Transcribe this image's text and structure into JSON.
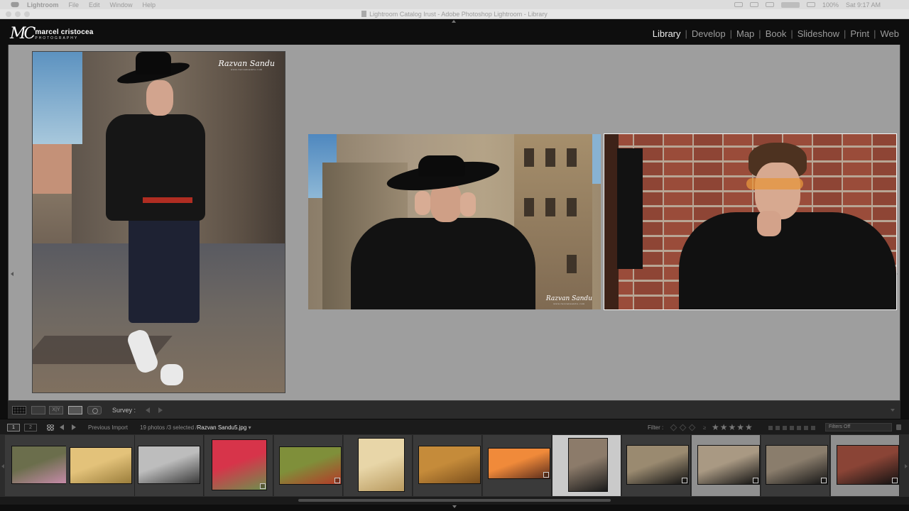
{
  "menubar": {
    "app_name": "Lightroom",
    "items": [
      "File",
      "Edit",
      "Window",
      "Help"
    ],
    "battery": "100%",
    "clock": "Sat 9:17 AM"
  },
  "window": {
    "title": "Lightroom Catalog Irust - Adobe Photoshop Lightroom - Library"
  },
  "identity": {
    "logo_mark": "MC",
    "logo_name": "marcel cristocea",
    "logo_sub": "PHOTOGRAPHY"
  },
  "modules": {
    "active": "Library",
    "items": [
      "Library",
      "Develop",
      "Map",
      "Book",
      "Slideshow",
      "Print",
      "Web"
    ]
  },
  "survey": {
    "watermark": "Razvan Sandu",
    "watermark_sub": "www.razvansandu.com"
  },
  "toolbar": {
    "compare_label": "X|Y",
    "survey_label": "Survey :"
  },
  "filmstrip_header": {
    "monitor_1": "1",
    "monitor_2": "2",
    "source": "Previous Import",
    "count": "19 photos /3 selected /",
    "selected_file": "Razvan Sandu5.jpg",
    "dropdown_caret": "▾",
    "filter_label": "Filter :",
    "rating_op": "≥",
    "stars": "★★★★★",
    "filters_off": "Filters Off"
  },
  "filmstrip": {
    "thumbnails": [
      {
        "subject": "pink hydrangea with butterfly",
        "colors": [
          "#6b6e4c",
          "#c58aa8"
        ]
      },
      {
        "subject": "wheat field at sunset",
        "colors": [
          "#e3c27a",
          "#9a7d3b"
        ]
      },
      {
        "subject": "black and white couple",
        "colors": [
          "#bdbdbd",
          "#3a3a3a"
        ]
      },
      {
        "subject": "red flowers",
        "colors": [
          "#d7344a",
          "#6e8f4e"
        ]
      },
      {
        "subject": "red poppy field",
        "colors": [
          "#7f8f3a",
          "#b43a28"
        ]
      },
      {
        "subject": "wheat ear close-up",
        "colors": [
          "#e8d6a8",
          "#b99a5f"
        ]
      },
      {
        "subject": "golden wheat stalks",
        "colors": [
          "#c58b3a",
          "#7a4e1c"
        ]
      },
      {
        "subject": "sunset over clouds",
        "colors": [
          "#f08a3a",
          "#5a2c1c"
        ]
      },
      {
        "subject": "walking portrait",
        "colors": [
          "#8c7b6a",
          "#1a1a1a"
        ]
      },
      {
        "subject": "portrait with hat",
        "colors": [
          "#9a8a70",
          "#121212"
        ]
      },
      {
        "subject": "adjusting sunglasses",
        "colors": [
          "#a99983",
          "#101010"
        ]
      },
      {
        "subject": "seated portrait",
        "colors": [
          "#8a7d6c",
          "#151515"
        ]
      },
      {
        "subject": "brick wall portrait",
        "colors": [
          "#8a4436",
          "#121212"
        ]
      }
    ]
  },
  "colors": {
    "background": "#0e0e0e",
    "content": "#9e9e9e",
    "module_active": "#ececec",
    "module_inactive": "#9c9c9c"
  }
}
